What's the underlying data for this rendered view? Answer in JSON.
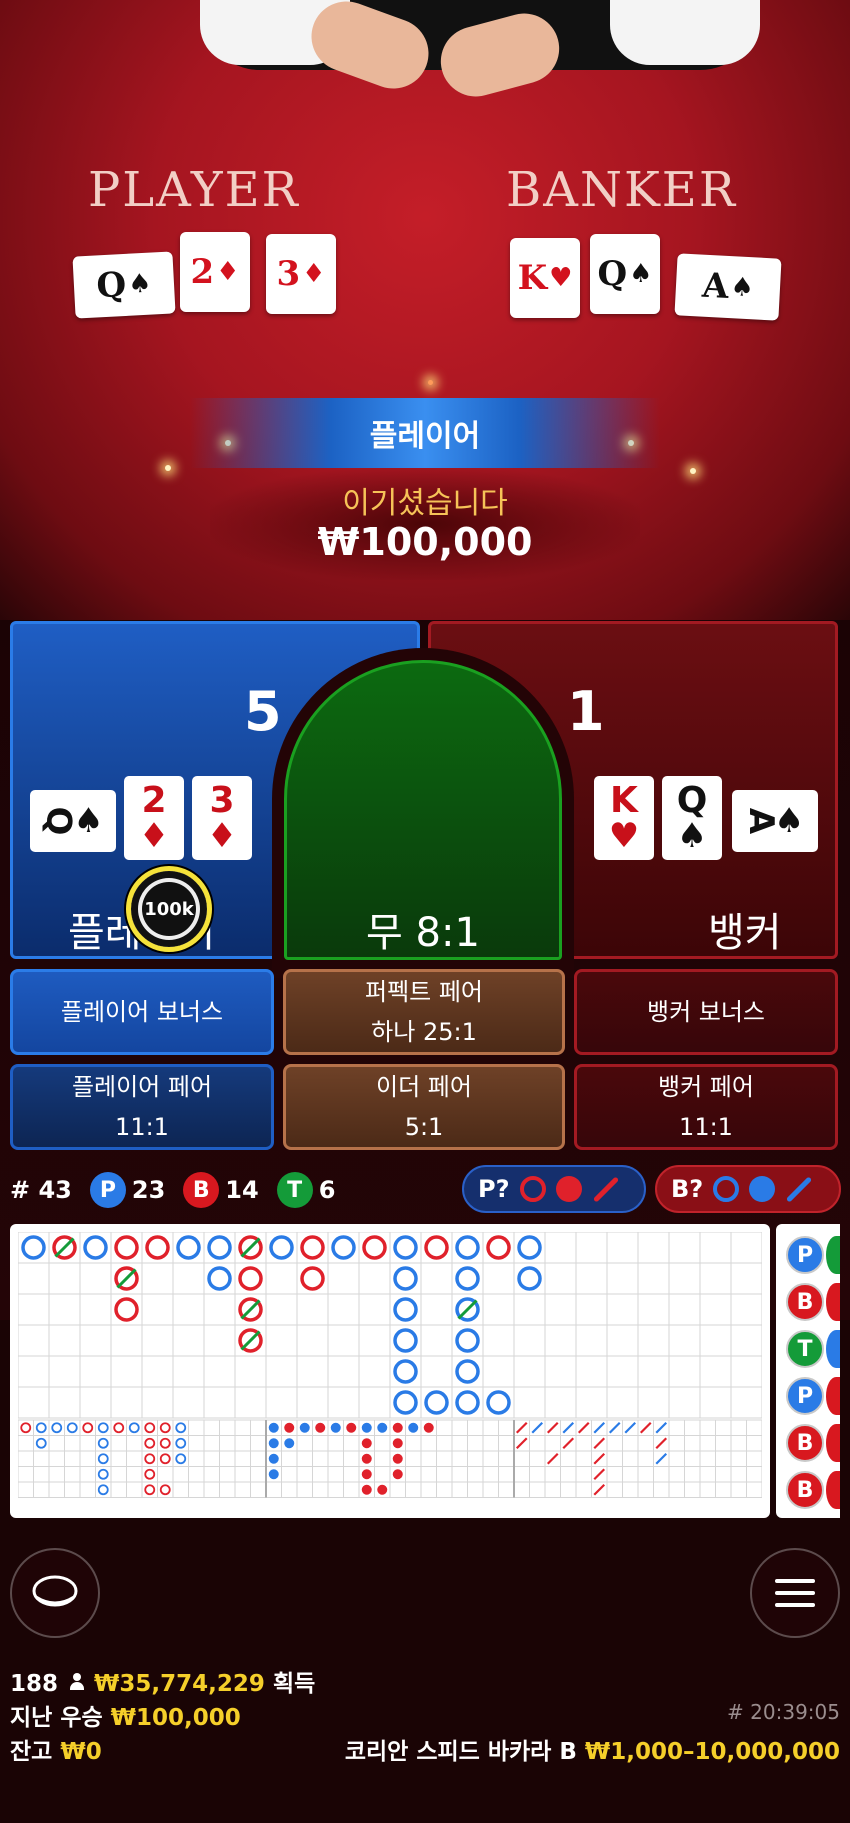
{
  "video": {
    "player_label": "PLAYER",
    "banker_label": "BANKER",
    "player_cards": [
      {
        "rank": "Q",
        "suit": "♠",
        "color": "black"
      },
      {
        "rank": "2",
        "suit": "♦",
        "color": "red"
      },
      {
        "rank": "3",
        "suit": "♦",
        "color": "red"
      }
    ],
    "banker_cards": [
      {
        "rank": "K",
        "suit": "♥",
        "color": "red"
      },
      {
        "rank": "Q",
        "suit": "♠",
        "color": "black"
      },
      {
        "rank": "A",
        "suit": "♠",
        "color": "black"
      }
    ],
    "result_title": "플레이어",
    "result_message": "이기셨습니다",
    "win_amount": "₩100,000"
  },
  "betting": {
    "player_score": "5",
    "banker_score": "1",
    "player_label": "플레이어",
    "banker_label": "뱅커",
    "tie_label": "무 8:1",
    "chip_value": "100k",
    "player_cards": [
      {
        "rank": "Q",
        "suit": "♠",
        "color": "black"
      },
      {
        "rank": "2",
        "suit": "♦",
        "color": "red"
      },
      {
        "rank": "3",
        "suit": "♦",
        "color": "red"
      }
    ],
    "banker_cards": [
      {
        "rank": "K",
        "suit": "♥",
        "color": "red"
      },
      {
        "rank": "Q",
        "suit": "♠",
        "color": "black"
      },
      {
        "rank": "A",
        "suit": "♠",
        "color": "black"
      }
    ]
  },
  "side_bets": {
    "player_bonus": "플레이어 보너스",
    "perfect_pair": "퍼펙트 페어",
    "perfect_pair_odds": "하나 25:1",
    "banker_bonus": "뱅커 보너스",
    "player_pair": "플레이어 페어",
    "player_pair_odds": "11:1",
    "either_pair": "이더 페어",
    "either_pair_odds": "5:1",
    "banker_pair": "뱅커 페어",
    "banker_pair_odds": "11:1"
  },
  "stats": {
    "rounds": "# 43",
    "player_badge": "P",
    "player_count": "23",
    "banker_badge": "B",
    "banker_count": "14",
    "tie_badge": "T",
    "tie_count": "6",
    "player_predict": "P?",
    "banker_predict": "B?"
  },
  "side_board": [
    "P",
    "B",
    "T",
    "P",
    "B",
    "B"
  ],
  "footer": {
    "players_count": "188",
    "total_winnings": "₩35,774,229",
    "winnings_suffix": "획득",
    "last_win_label": "지난 우승",
    "last_win_value": "₩100,000",
    "balance_label": "잔고",
    "balance_value": "₩0",
    "game_id": "# 20:39:05",
    "table_name": "코리안 스피드 바카라 B",
    "table_limits": "₩1,000–10,000,000"
  },
  "colors": {
    "player_blue": "#2a7be6",
    "banker_red": "#d8181f",
    "tie_green": "#149b39",
    "gold": "#f5cf2a"
  }
}
